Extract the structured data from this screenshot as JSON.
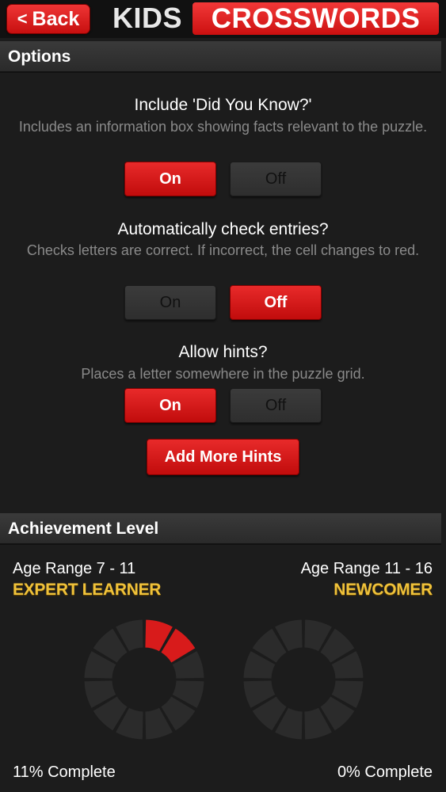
{
  "header": {
    "back_label": "Back",
    "back_chevron": "<",
    "brand_kids": "KIDS",
    "brand_crosswords": "CROSSWORDS"
  },
  "options": {
    "section_title": "Options",
    "items": [
      {
        "title": "Include 'Did You Know?'",
        "description": "Includes an information box showing facts relevant to the puzzle.",
        "on_label": "On",
        "off_label": "Off",
        "selected": "On"
      },
      {
        "title": "Automatically check entries?",
        "description": "Checks letters are correct. If incorrect, the cell changes to red.",
        "on_label": "On",
        "off_label": "Off",
        "selected": "Off"
      },
      {
        "title": "Allow hints?",
        "description": "Places a letter somewhere in the puzzle grid.",
        "on_label": "On",
        "off_label": "Off",
        "selected": "On"
      }
    ],
    "add_hints_label": "Add More Hints"
  },
  "achievement": {
    "section_title": "Achievement Level",
    "left": {
      "age_range": "Age Range 7 - 11",
      "level": "EXPERT LEARNER",
      "complete_text": "11% Complete",
      "segments_filled": 2,
      "segments_total": 12
    },
    "right": {
      "age_range": "Age Range 11 - 16",
      "level": "NEWCOMER",
      "complete_text": "0% Complete",
      "segments_filled": 0,
      "segments_total": 12
    }
  },
  "colors": {
    "accent_red": "#d81b1b",
    "level_gold": "#f0c23a",
    "segment_empty": "#2b2b2b",
    "background": "#1c1c1c"
  }
}
